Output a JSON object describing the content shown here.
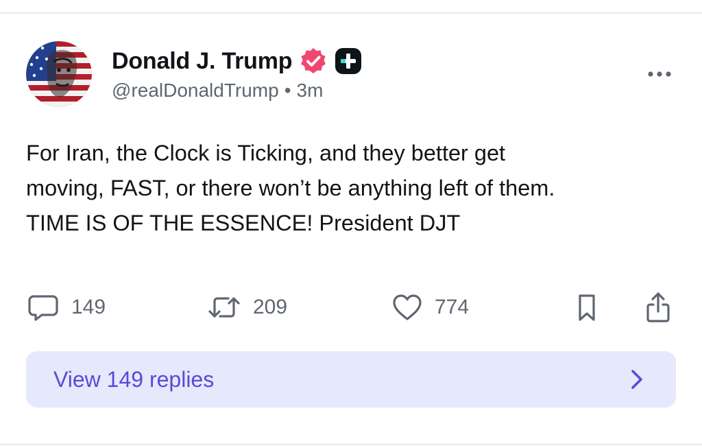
{
  "post": {
    "author": {
      "display_name": "Donald J. Trump",
      "handle": "@realDonaldTrump",
      "avatar": "avatar-flag-portrait"
    },
    "separator": "•",
    "timestamp": "3m",
    "text_lines": [
      "For Iran, the Clock is Ticking, and they better get",
      "moving, FAST, or there won’t be anything left of them.",
      "TIME IS OF THE ESSENCE! President DJT"
    ],
    "actions": {
      "reply_count": "149",
      "repost_count": "209",
      "like_count": "774"
    },
    "view_replies_label": "View 149 replies"
  },
  "icons": {
    "verified": "verified-check-badge-icon",
    "plus": "plus-badge-icon",
    "more": "more-horizontal-icon",
    "reply": "comment-bubble-icon",
    "repost": "repost-arrows-icon",
    "like": "heart-icon",
    "bookmark": "bookmark-icon",
    "share": "share-upload-icon",
    "chevron": "chevron-right-icon"
  },
  "colors": {
    "verified_badge": "#f0476f",
    "accent_purple": "#5a49d8",
    "view_replies_bg": "#e6e8fc",
    "muted_text": "#5f6670",
    "icon_gray": "#5f6670"
  }
}
